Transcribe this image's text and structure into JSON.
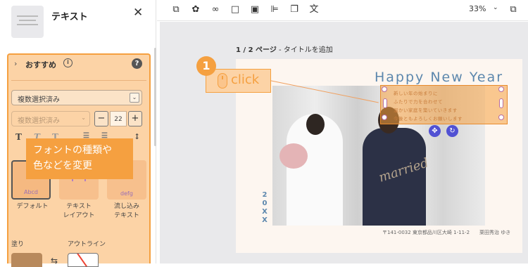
{
  "sidebar": {
    "title": "テキスト",
    "recommend_label": "おすすめ",
    "select_value": "複数選択済み",
    "font_select_value": "複数選択済み",
    "font_size": "22",
    "style_cards": [
      {
        "caption": "デフォルト",
        "sample": "Abcd"
      },
      {
        "caption": "テキスト\nレイアウト",
        "sample": ""
      },
      {
        "caption": "流し込み\nテキスト",
        "sample": "defg"
      }
    ],
    "paint_label": "塗り",
    "outline_label": "アウトライン"
  },
  "callouts": {
    "font_change": "フォントの種類や\n色などを変更",
    "step_number": "1",
    "click_label": "click"
  },
  "toolbar": {
    "zoom": "33%"
  },
  "canvas": {
    "page_indicator": "1 / 2 ページ",
    "page_title_prompt": "タイトルを追加",
    "greeting": "Happy New Year",
    "year_text": "20XX",
    "address": "〒141-0032 東京都品川区大崎 1-11-2　　栗田秀治 ゆき",
    "sign_text": "married",
    "message_lines": [
      "新しい年の始まりに",
      "ふたりで力を合わせて",
      "温かい家庭を築いていきます",
      "今後ともよろしくお願いします"
    ]
  },
  "colors": {
    "accent_orange": "#f5a040",
    "greeting_blue": "#5c87ad",
    "handle_purple": "#5151d3"
  }
}
